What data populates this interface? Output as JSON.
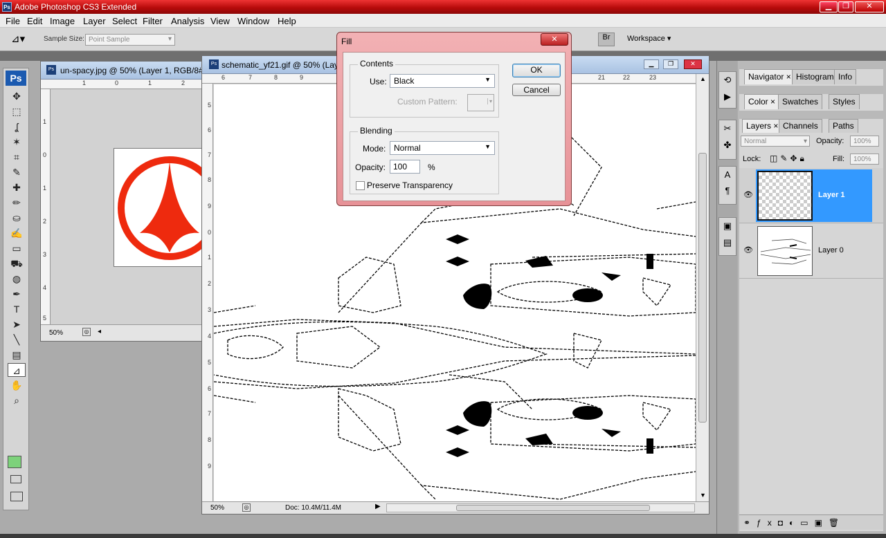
{
  "app": {
    "title": "Adobe Photoshop CS3 Extended",
    "icon_label": "Ps"
  },
  "window_controls": {
    "minimize": "▁",
    "maximize": "❐",
    "close": "✕"
  },
  "menu": [
    "File",
    "Edit",
    "Image",
    "Layer",
    "Select",
    "Filter",
    "Analysis",
    "View",
    "Window",
    "Help"
  ],
  "options_bar": {
    "sample_size_label": "Sample Size:",
    "sample_size_value": "Point Sample",
    "workspace_label": "Workspace"
  },
  "tools": [
    "move-icon",
    "marquee-icon",
    "lasso-icon",
    "magic-wand-icon",
    "crop-icon",
    "slice-icon",
    "healing-icon",
    "brush-icon",
    "stamp-icon",
    "history-brush-icon",
    "eraser-icon",
    "bucket-icon",
    "dodge-icon",
    "pen-icon",
    "type-icon",
    "path-select-icon",
    "line-icon",
    "notes-icon",
    "eyedropper-icon",
    "hand-icon",
    "zoom-icon"
  ],
  "tool_glyphs": [
    "✥",
    "⬚",
    "ʆ",
    "✶",
    "⌗",
    "✎",
    "✚",
    "✏",
    "⛀",
    "✍",
    "▭",
    "⛟",
    "◍",
    "✒",
    "T",
    "➤",
    "╲",
    "▤",
    "⊿",
    "✋",
    "⌕"
  ],
  "colors": {
    "foreground": "#7dd27b",
    "background": "#e8e8e8",
    "accent": "#3399ff",
    "logo_red": "#ee2a0e"
  },
  "doc1": {
    "title": "un-spacy.jpg @ 50% (Layer 1, RGB/8#)",
    "zoom": "50%",
    "hruler": [
      "1",
      "0",
      "1",
      "2"
    ],
    "vruler": [
      "1",
      "0",
      "1",
      "2",
      "3",
      "4",
      "5"
    ]
  },
  "doc2": {
    "title": "schematic_yf21.gif @ 50% (Laye",
    "zoom": "50%",
    "doc_size": "Doc: 10.4M/11.4M",
    "hruler": [
      "6",
      "7",
      "8",
      "9",
      "21",
      "22",
      "23"
    ],
    "vruler": [
      "5",
      "6",
      "7",
      "8",
      "9",
      "0",
      "1",
      "2",
      "3",
      "4",
      "5",
      "6",
      "7",
      "8",
      "9"
    ]
  },
  "fill_dialog": {
    "title": "Fill",
    "contents_legend": "Contents",
    "use_label": "Use:",
    "use_value": "Black",
    "custom_pattern_label": "Custom Pattern:",
    "blending_legend": "Blending",
    "mode_label": "Mode:",
    "mode_value": "Normal",
    "opacity_label": "Opacity:",
    "opacity_value": "100",
    "opacity_unit": "%",
    "preserve_label": "Preserve Transparency",
    "ok_label": "OK",
    "cancel_label": "Cancel"
  },
  "panels": {
    "group1_tabs": [
      "Navigator",
      "Histogram",
      "Info"
    ],
    "group2_tabs": [
      "Color",
      "Swatches",
      "Styles"
    ],
    "group3_tabs": [
      "Layers",
      "Channels",
      "Paths"
    ],
    "blend_mode": "Normal",
    "opacity_label": "Opacity:",
    "opacity_value": "100%",
    "lock_label": "Lock:",
    "fill_label": "Fill:",
    "fill_value": "100%",
    "layers": [
      {
        "name": "Layer 1",
        "selected": true
      },
      {
        "name": "Layer 0",
        "selected": false
      }
    ]
  }
}
